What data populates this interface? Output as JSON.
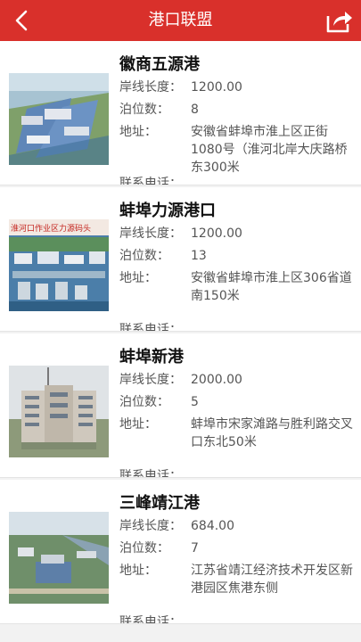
{
  "header": {
    "title": "港口联盟"
  },
  "labels": {
    "length": "岸线长度：",
    "berths": "泊位数：",
    "address": "地址：",
    "phone": "联系电话："
  },
  "ports": [
    {
      "name": "徽商五源港",
      "length": "1200.00",
      "berths": "8",
      "address": "安徽省蚌埠市淮上区正街1080号（淮河北岸大庆路桥东300米",
      "phone": ""
    },
    {
      "name": "蚌埠力源港口",
      "length": "1200.00",
      "berths": "13",
      "address": "安徽省蚌埠市淮上区306省道南150米",
      "phone": "",
      "thumb_text": "淮河口作业区力源码头"
    },
    {
      "name": "蚌埠新港",
      "length": "2000.00",
      "berths": "5",
      "address": "蚌埠市宋家滩路与胜利路交叉口东北50米",
      "phone": ""
    },
    {
      "name": "三峰靖江港",
      "length": "684.00",
      "berths": "7",
      "address": "江苏省靖江经济技术开发区新港园区焦港东侧",
      "phone": ""
    }
  ]
}
